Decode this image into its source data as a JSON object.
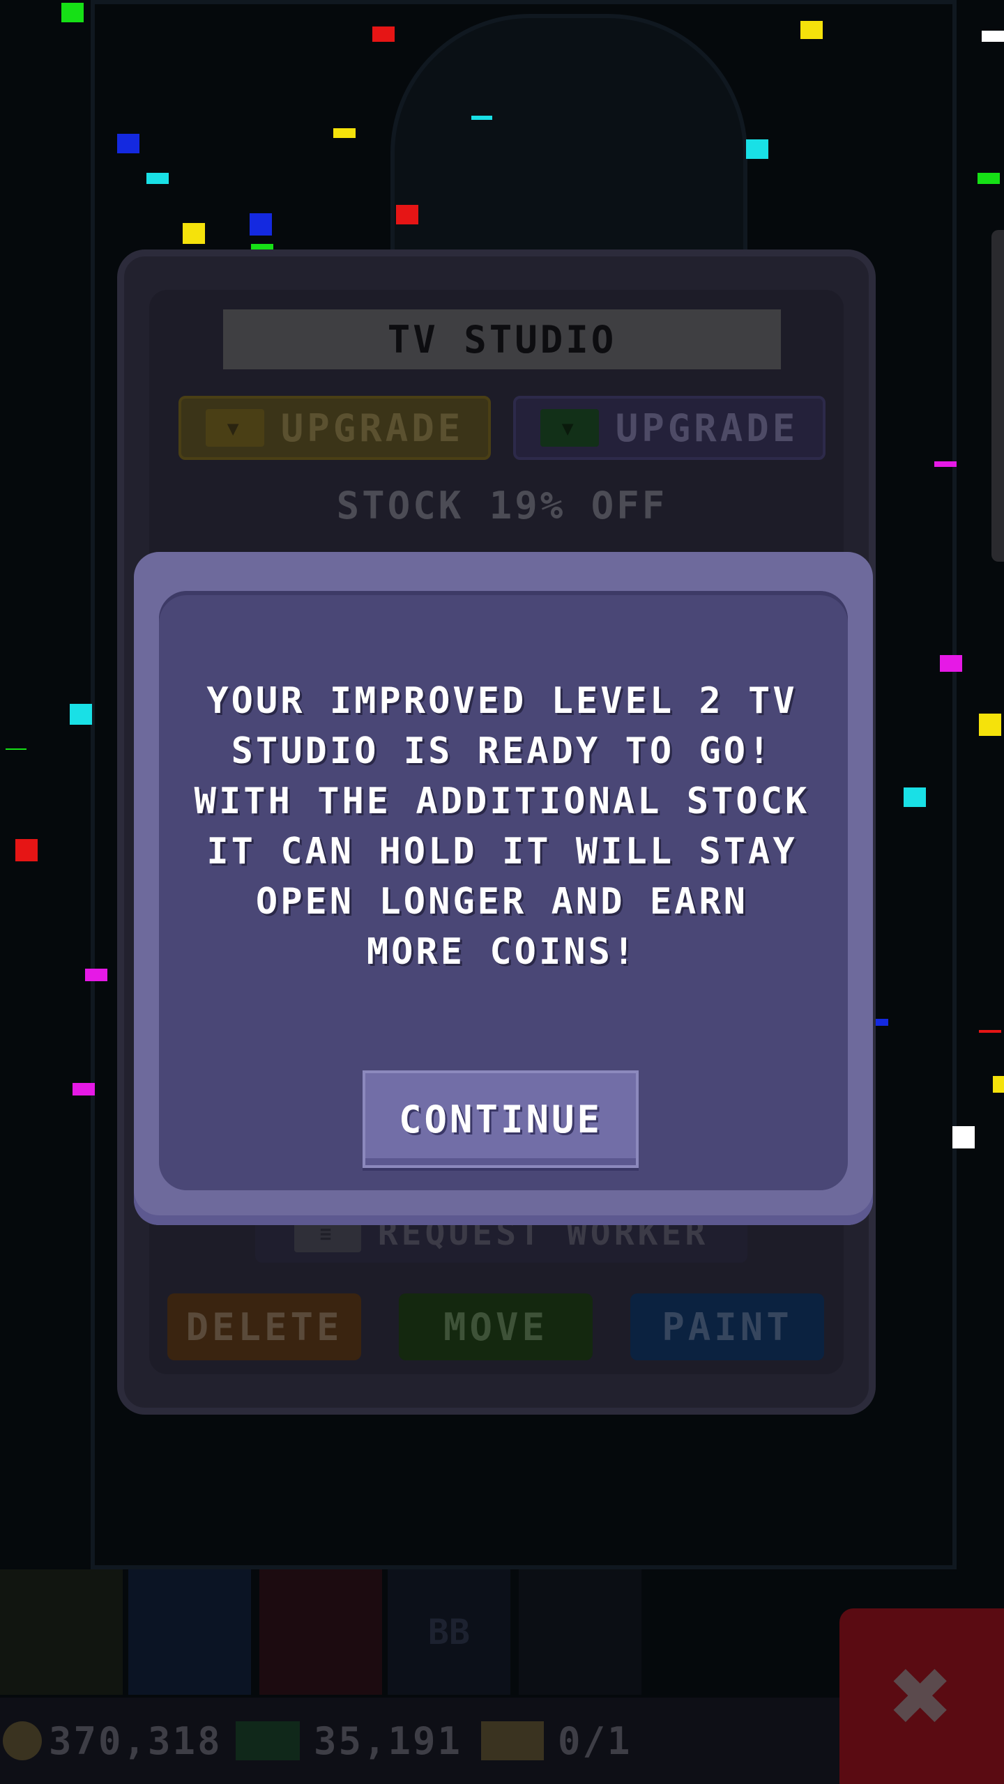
{
  "panel": {
    "title": "TV STUDIO",
    "upgrade_coins_label": "UPGRADE",
    "upgrade_bux_label": "UPGRADE",
    "stock_text": "STOCK 19% OFF",
    "request_worker_label": "REQUEST WORKER",
    "delete_label": "DELETE",
    "move_label": "MOVE",
    "paint_label": "PAINT"
  },
  "modal": {
    "message_lines": [
      "YOUR IMPROVED LEVEL 2 TV",
      "STUDIO IS READY TO GO!",
      "WITH THE ADDITIONAL STOCK",
      "IT CAN HOLD IT WILL STAY",
      "OPEN LONGER AND EARN",
      "MORE COINS!"
    ],
    "continue_label": "CONTINUE"
  },
  "toolbar": {
    "slot_label": "BB"
  },
  "status": {
    "coins": "370,318",
    "bux": "35,191",
    "tickets": "0/1"
  },
  "colors": {
    "modal_bg": "#6e6a9c",
    "modal_inner": "#4a4776",
    "delete": "#3a2410",
    "move": "#14280f",
    "paint": "#0b2240",
    "close": "#5a0b12"
  },
  "icons": {
    "coin": "coin-icon",
    "bux": "bux-icon",
    "ticket": "ticket-icon",
    "close": "close-icon"
  }
}
